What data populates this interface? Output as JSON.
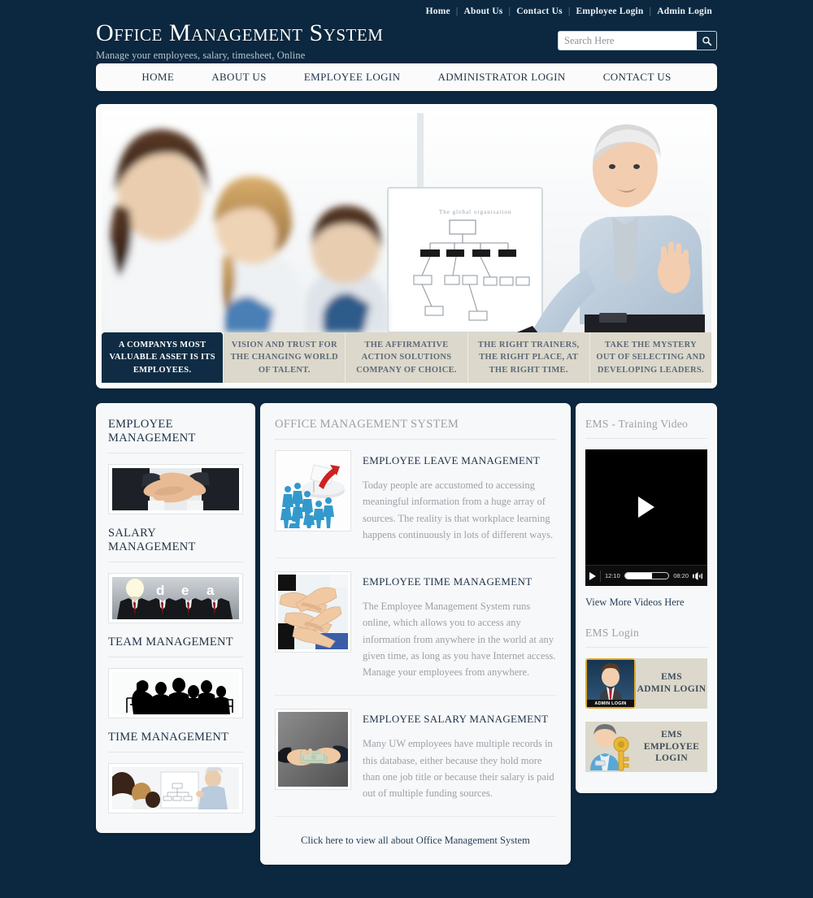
{
  "topnav": {
    "links": [
      "Home",
      "About Us",
      "Contact Us",
      "Employee Login",
      "Admin Login"
    ]
  },
  "brand": {
    "title": "Office Management System",
    "tagline": "Manage your employees, salary, timesheet, Online"
  },
  "search": {
    "placeholder": "Search Here",
    "value": "",
    "icon": "search-icon"
  },
  "mainnav": {
    "items": [
      "HOME",
      "ABOUT US",
      "EMPLOYEE LOGIN",
      "ADMINISTRATOR LOGIN",
      "CONTACT US"
    ]
  },
  "banner": {
    "captions": [
      {
        "text": "A COMPANYS MOST VALUABLE ASSET IS ITS EMPLOYEES.",
        "active": true
      },
      {
        "text": "VISION AND TRUST FOR THE CHANGING WORLD OF TALENT.",
        "active": false
      },
      {
        "text": "THE AFFIRMATIVE ACTION SOLUTIONS COMPANY OF CHOICE.",
        "active": false
      },
      {
        "text": "THE RIGHT TRAINERS, THE RIGHT PLACE, AT THE RIGHT TIME.",
        "active": false
      },
      {
        "text": "TAKE THE MYSTERY OUT OF SELECTING AND DEVELOPING LEADERS.",
        "active": false
      }
    ]
  },
  "left_sidebar": {
    "sections": [
      {
        "label": "EMPLOYEE MANAGEMENT",
        "image": "handshake-team-photo"
      },
      {
        "label": "SALARY MANAGEMENT",
        "image": "idea-suits-photo"
      },
      {
        "label": "TEAM MANAGEMENT",
        "image": "meeting-silhouette-photo"
      },
      {
        "label": "TIME MANAGEMENT",
        "image": "presentation-whiteboard-photo"
      }
    ]
  },
  "main": {
    "heading": "OFFICE MANAGEMENT SYSTEM",
    "articles": [
      {
        "title": "EMPLOYEE LEAVE MANAGEMENT",
        "text": "Today people are accustomed to accessing meaningful information from a huge array of sources. The reality is that workplace learning happens continuously in lots of different ways.",
        "image": "crowd-red-arrow-photo"
      },
      {
        "title": "EMPLOYEE TIME MANAGEMENT",
        "text": "The Employee Management System runs online, which allows you to access any information from anywhere in the world at any given time, as long as you have Internet access. Manage your employees from anywhere.",
        "image": "stacked-hands-photo"
      },
      {
        "title": "EMPLOYEE SALARY MANAGEMENT",
        "text": "Many UW employees have multiple records in this database, either because they hold more than one job title or because their salary is paid out of multiple funding sources.",
        "image": "cash-exchange-photo"
      }
    ],
    "view_all": "Click here to view all about Office Management System"
  },
  "right_sidebar": {
    "video_heading": "EMS - Training Video",
    "video": {
      "play_icon": "play-icon",
      "elapsed": "12:10",
      "remaining": "08:20",
      "volume_icon": "volume-icon",
      "progress_percent": 62
    },
    "video_link": "View More Videos Here",
    "login_heading": "EMS Login",
    "logins": [
      {
        "line1": "EMS",
        "line2": "ADMIN LOGIN",
        "line3": "",
        "badge": "ADMIN LOGIN",
        "icon": "admin-avatar-icon"
      },
      {
        "line1": "EMS",
        "line2": "EMPLOYEE",
        "line3": "LOGIN",
        "badge": "",
        "icon": "employee-key-icon"
      }
    ]
  },
  "colors": {
    "page_bg": "#0b2840",
    "panel_bg": "#f7f8f9",
    "navy": "#0f2c44",
    "beige": "#dcd8cb",
    "muted_text": "#9aa1a8",
    "accent_gold": "#e0a92a"
  }
}
